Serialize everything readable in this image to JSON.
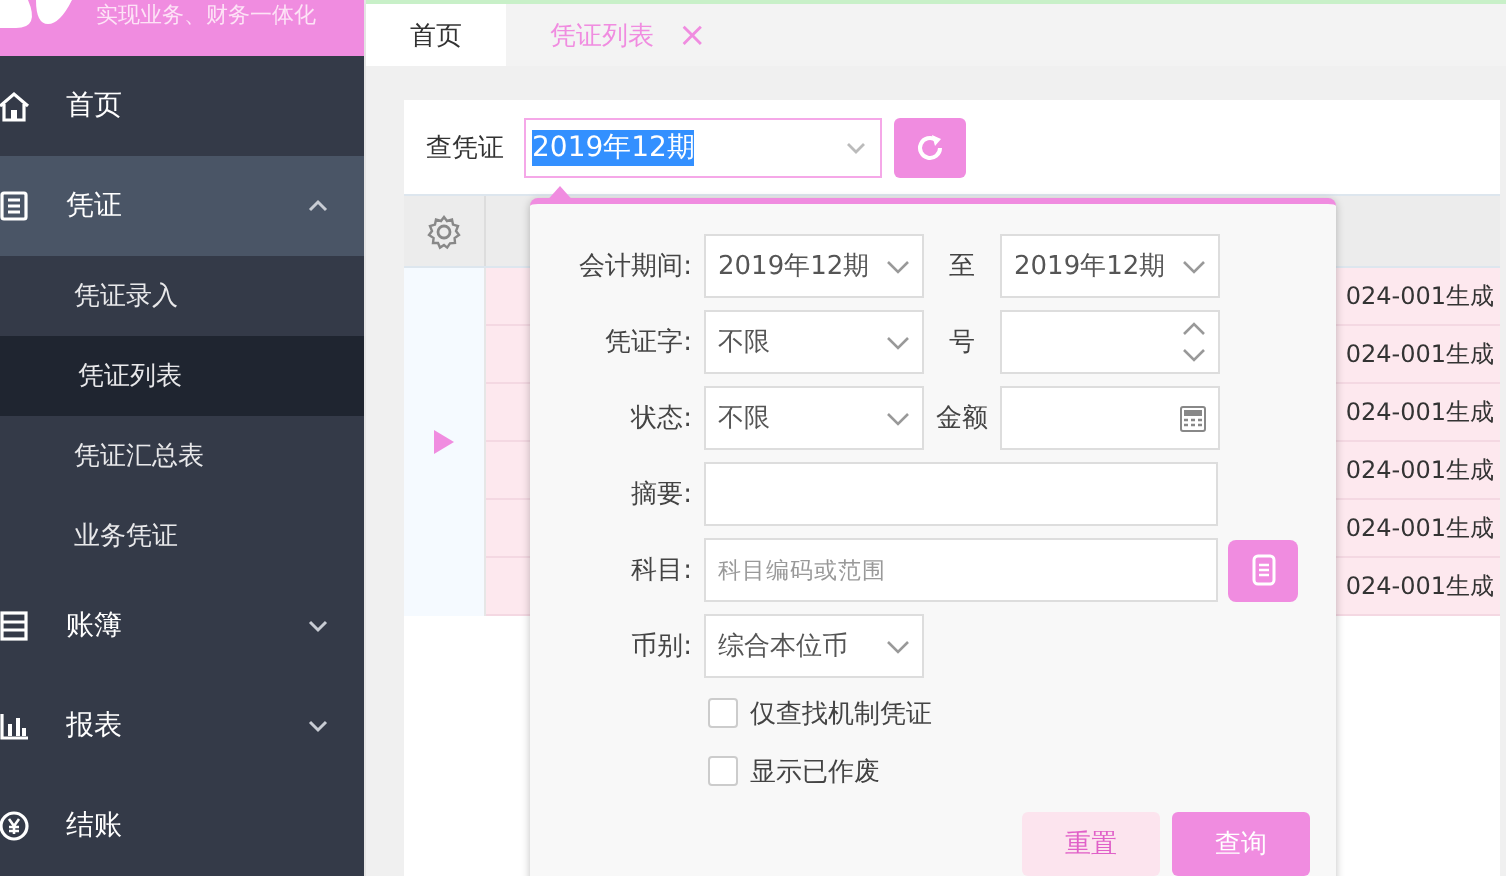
{
  "brand": {
    "tagline": "实现业务、财务一体化"
  },
  "sidebar": {
    "items": [
      {
        "label": "首页",
        "kind": "link"
      },
      {
        "label": "凭证",
        "kind": "group",
        "expanded": true,
        "children": [
          {
            "label": "凭证录入",
            "selected": false
          },
          {
            "label": "凭证列表",
            "selected": true
          },
          {
            "label": "凭证汇总表",
            "selected": false
          },
          {
            "label": "业务凭证",
            "selected": false
          }
        ]
      },
      {
        "label": "账簿",
        "kind": "group",
        "expanded": false
      },
      {
        "label": "报表",
        "kind": "group",
        "expanded": false
      },
      {
        "label": "结账",
        "kind": "link"
      }
    ]
  },
  "tabs": [
    {
      "label": "首页",
      "selected": false
    },
    {
      "label": "凭证列表",
      "selected": true,
      "close": "×"
    }
  ],
  "toolbar": {
    "label": "查凭证",
    "period": "2019年12期"
  },
  "table": {
    "rows": [
      {
        "column_3": "024-001生成"
      },
      {
        "column_3": "024-001生成"
      },
      {
        "column_3": "024-001生成"
      },
      {
        "column_3": "024-001生成"
      },
      {
        "column_3": "024-001生成"
      },
      {
        "column_3": "024-001生成"
      }
    ]
  },
  "query_popup": {
    "rows": [
      {
        "label": "会计期间:",
        "field": {
          "kind": "select",
          "value": "2019年12期"
        },
        "label2": "至",
        "field2": {
          "kind": "select",
          "value": "2019年12期"
        }
      },
      {
        "label": "凭证字:",
        "field": {
          "kind": "select",
          "value": "不限"
        },
        "label2": "号",
        "field2": {
          "kind": "number"
        }
      },
      {
        "label": "状态:",
        "field": {
          "kind": "select",
          "value": "不限"
        },
        "label2": "金额",
        "field2": {
          "kind": "amount"
        }
      },
      {
        "label": "摘要:",
        "field": {
          "kind": "text"
        }
      },
      {
        "label": "科目:",
        "field": {
          "kind": "picker",
          "placeholder": "科目编码或范围"
        }
      },
      {
        "label": "币别:",
        "field": {
          "kind": "select",
          "value": "综合本位币"
        }
      }
    ],
    "checkboxes": [
      {
        "label": "仅查找机制凭证",
        "checked": false
      },
      {
        "label": "显示已作废",
        "checked": false
      }
    ],
    "buttons": [
      {
        "label": "重置",
        "kind": "secondary"
      },
      {
        "label": "查询",
        "kind": "primary"
      }
    ]
  }
}
